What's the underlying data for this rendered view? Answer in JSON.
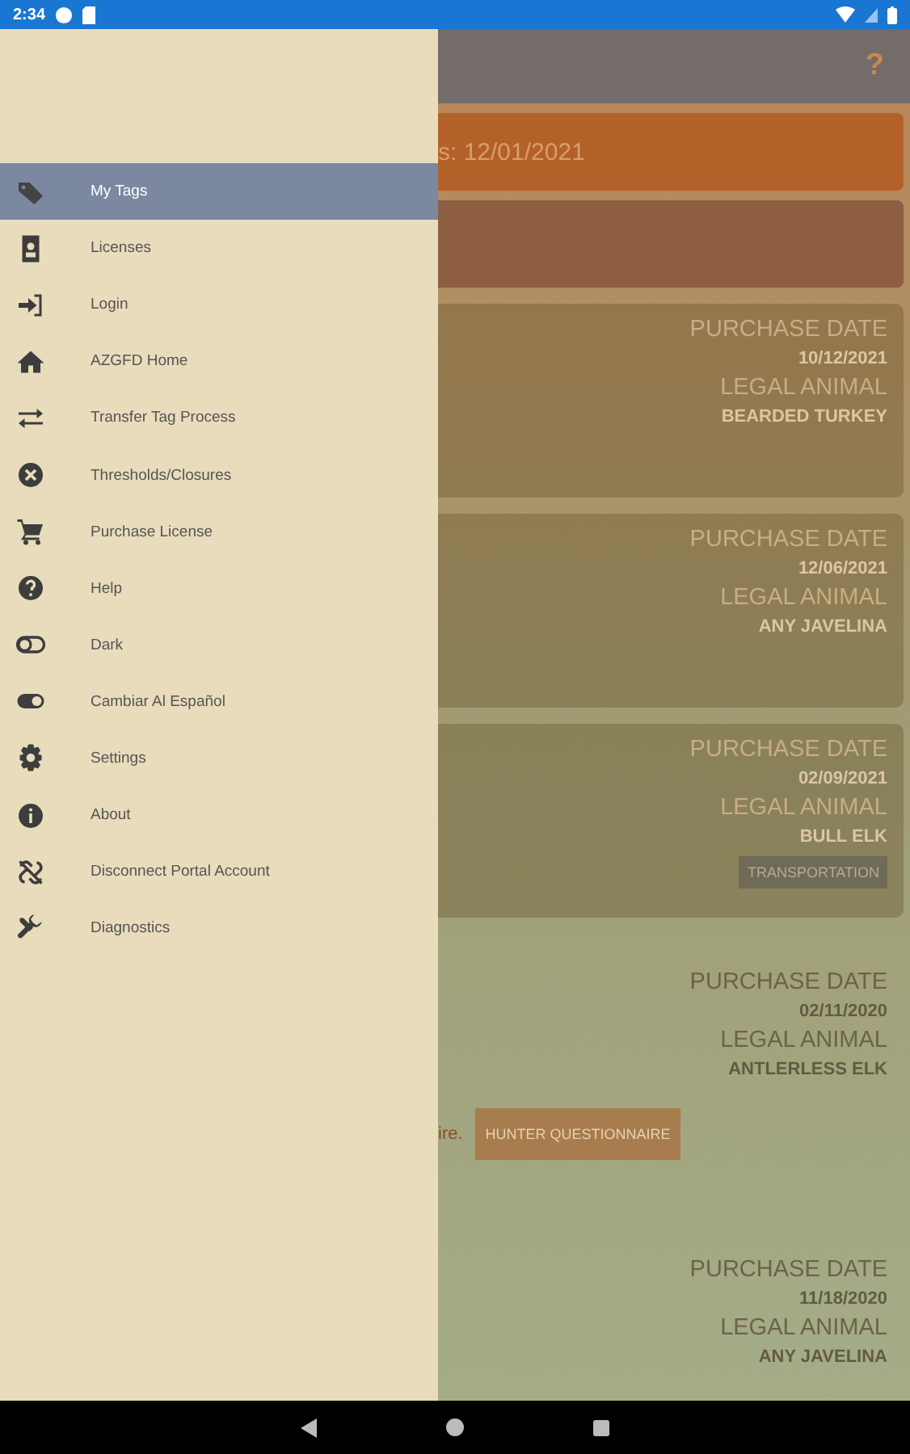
{
  "status_bar": {
    "time": "2:34"
  },
  "drawer": {
    "items": [
      {
        "label": "My Tags",
        "selected": true
      },
      {
        "label": "Licenses",
        "selected": false
      },
      {
        "label": "Login",
        "selected": false
      },
      {
        "label": "AZGFD Home",
        "selected": false
      },
      {
        "label": "Transfer Tag Process",
        "selected": false
      },
      {
        "label": "Thresholds/Closures",
        "selected": false
      },
      {
        "label": "Purchase License",
        "selected": false
      },
      {
        "label": "Help",
        "selected": false
      },
      {
        "label": "Dark",
        "selected": false
      },
      {
        "label": "Cambiar Al Español",
        "selected": false
      },
      {
        "label": "Settings",
        "selected": false
      },
      {
        "label": "About",
        "selected": false
      },
      {
        "label": "Disconnect Portal Account",
        "selected": false
      },
      {
        "label": "Diagnostics",
        "selected": false
      }
    ]
  },
  "header": {
    "help": "?"
  },
  "banner": {
    "text": "s: 12/01/2021"
  },
  "cards": [
    {
      "framed": true,
      "purchase_label": "PURCHASE DATE",
      "purchase_date": "10/12/2021",
      "animal_label": "LEGAL ANIMAL",
      "animal": "BEARDED TURKEY"
    },
    {
      "framed": true,
      "purchase_label": "PURCHASE DATE",
      "purchase_date": "12/06/2021",
      "animal_label": "LEGAL ANIMAL",
      "animal": "ANY JAVELINA"
    },
    {
      "framed": true,
      "purchase_label": "PURCHASE DATE",
      "purchase_date": "02/09/2021",
      "animal_label": "LEGAL ANIMAL",
      "animal": "BULL ELK",
      "button": "TRANSPORTATION"
    },
    {
      "framed": false,
      "purchase_label": "PURCHASE DATE",
      "purchase_date": "02/11/2020",
      "animal_label": "LEGAL ANIMAL",
      "animal": "ANTLERLESS ELK",
      "note": "ire.",
      "button": "HUNTER QUESTIONNAIRE"
    },
    {
      "framed": false,
      "purchase_label": "PURCHASE DATE",
      "purchase_date": "11/18/2020",
      "animal_label": "LEGAL ANIMAL",
      "animal": "ANY JAVELINA"
    }
  ]
}
